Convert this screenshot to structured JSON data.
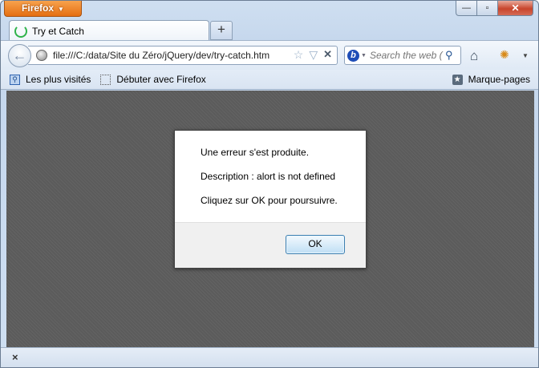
{
  "browser": {
    "menu_label": "Firefox"
  },
  "window_controls": {
    "minimize": "—",
    "maximize": "▫",
    "close": "✕"
  },
  "tab": {
    "title": "Try et Catch",
    "new_tab": "+"
  },
  "nav": {
    "back": "←",
    "url": "file:///C:/data/Site du Zéro/jQuery/dev/try-catch.htm",
    "search_placeholder": "Search the web (",
    "search_engine": "b"
  },
  "bookmarks": {
    "items": [
      "Les plus visités",
      "Débuter avec Firefox"
    ],
    "right": "Marque-pages"
  },
  "dialog": {
    "line1": "Une erreur s'est produite.",
    "line2": "Description : alort is not defined",
    "line3": "Cliquez sur OK pour poursuivre.",
    "ok_label": "OK"
  },
  "statusbar": {
    "close": "×"
  },
  "colors": {
    "firefox_orange": "#e56f12",
    "overlay_gray": "#5b5b5b",
    "ok_border": "#3c7fb1"
  }
}
